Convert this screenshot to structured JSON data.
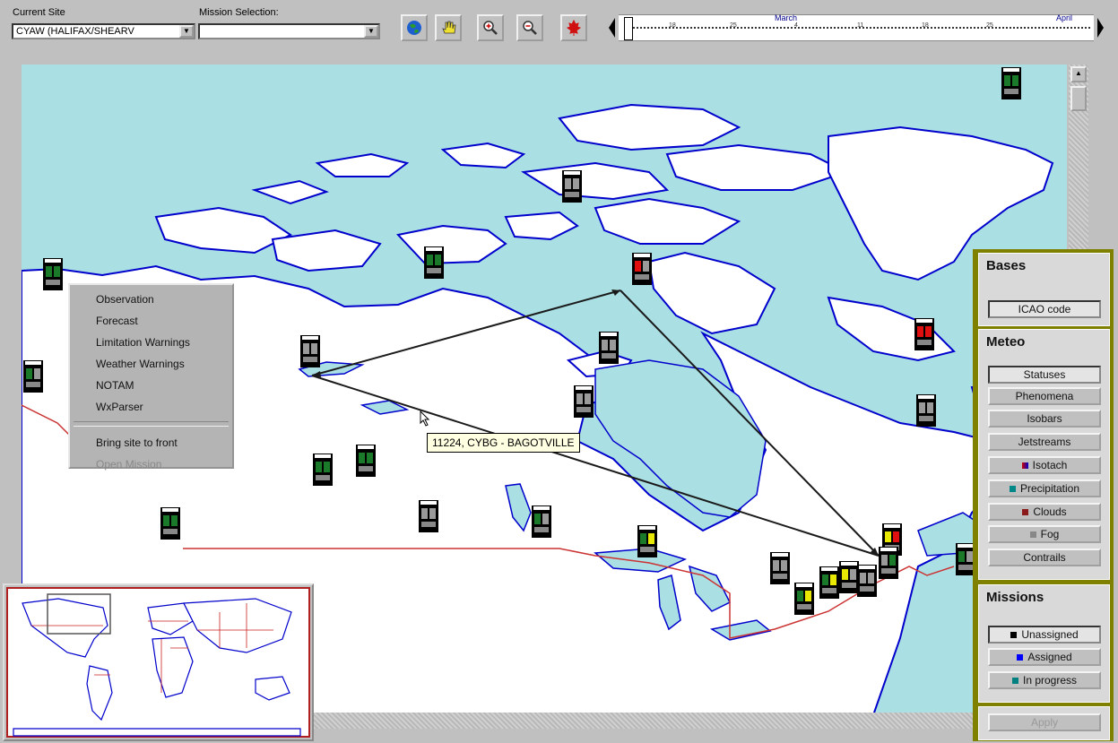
{
  "toolbar": {
    "current_site_label": "Current Site",
    "current_site_value": "CYAW   (HALIFAX/SHEARV",
    "mission_label": "Mission Selection:",
    "mission_value": "",
    "icons": [
      "globe-icon",
      "hand-icon",
      "zoom-in-icon",
      "zoom-out-icon",
      "maple-leaf-icon"
    ]
  },
  "timeline": {
    "months": [
      "March",
      "April"
    ],
    "ticks": [
      "18",
      "25",
      "4",
      "11",
      "18",
      "25"
    ]
  },
  "context_menu": {
    "items": [
      "Observation",
      "Forecast",
      "Limitation Warnings",
      "Weather Warnings",
      "NOTAM",
      "WxParser"
    ],
    "bring_to_front": "Bring site to front",
    "open_mission": "Open Mission"
  },
  "tooltip": "11224, CYBG - BAGOTVILLE",
  "panel": {
    "bases": {
      "title": "Bases",
      "buttons": [
        "ICAO code"
      ]
    },
    "meteo": {
      "title": "Meteo",
      "buttons": [
        "Statuses",
        "Phenomena",
        "Isobars",
        "Jetstreams",
        "Isotach",
        "Precipitation",
        "Clouds",
        "Fog",
        "Contrails"
      ]
    },
    "missions": {
      "title": "Missions",
      "buttons": [
        "Unassigned",
        "Assigned",
        "In progress"
      ]
    },
    "apply": "Apply"
  },
  "colors": {
    "water": "#aadfe4",
    "coast": "#0000cc",
    "border": "#cc3333",
    "panel_bg": "#7f7f00",
    "status_green": "#1a7a2a",
    "status_red": "#e01010",
    "status_yellow": "#e8e800",
    "status_grey": "#9a9a9a",
    "isotach": "#8000ff",
    "precipitation": "#008888",
    "clouds": "#8b1a1a",
    "fog": "#888888",
    "unassigned": "#000000",
    "assigned": "#0000ff",
    "in_progress": "#008080"
  }
}
